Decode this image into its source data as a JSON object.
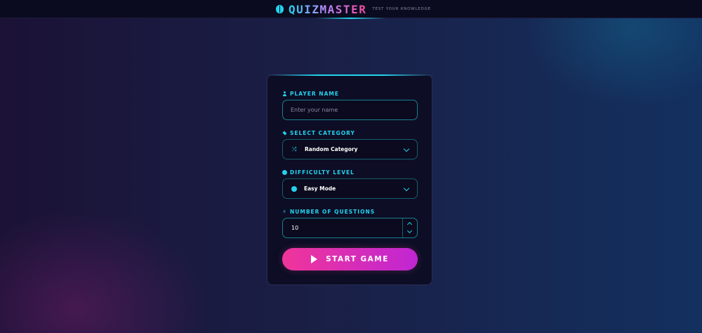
{
  "header": {
    "title": "QUIZMASTER",
    "tagline": "TEST YOUR KNOWLEDGE",
    "logo_icon": "brain-icon"
  },
  "form": {
    "player_name": {
      "label": "PLAYER NAME",
      "icon": "user-icon",
      "placeholder": "Enter your name",
      "value": ""
    },
    "category": {
      "label": "SELECT CATEGORY",
      "icon": "layers-icon",
      "selected": "Random Category",
      "option_icon": "shuffle-icon"
    },
    "difficulty": {
      "label": "DIFFICULTY LEVEL",
      "icon": "gauge-icon",
      "selected": "Easy Mode",
      "option_icon": "circle-icon"
    },
    "questions": {
      "label": "NUMBER OF QUESTIONS",
      "icon": "bolt-icon",
      "value": "10"
    },
    "start_label": "START GAME"
  },
  "colors": {
    "accent": "#22d3ee",
    "button_start": "#f0359a",
    "button_end": "#c026d3",
    "card_bg": "#0c0a20"
  }
}
